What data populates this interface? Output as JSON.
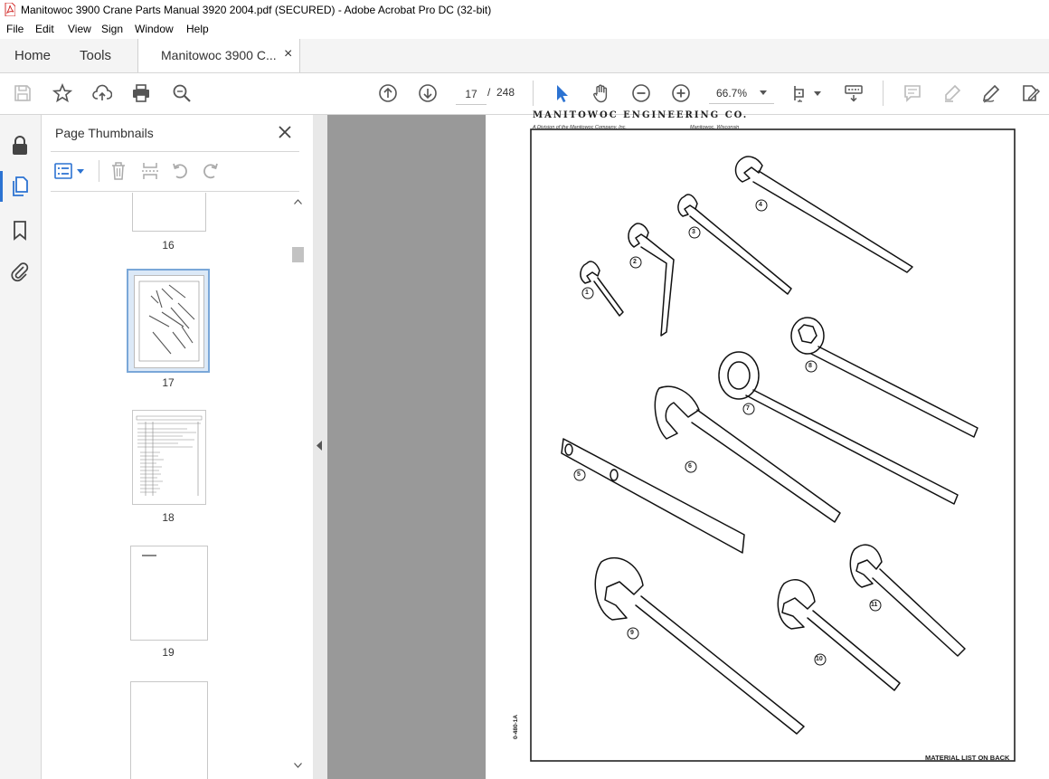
{
  "window": {
    "title": "Manitowoc 3900 Crane Parts Manual 3920 2004.pdf (SECURED) - Adobe Acrobat Pro DC (32-bit)"
  },
  "menu": [
    "File",
    "Edit",
    "View",
    "Sign",
    "Window",
    "Help"
  ],
  "tabs": {
    "home": "Home",
    "tools": "Tools",
    "document": "Manitowoc 3900 C...",
    "close": "×"
  },
  "toolbar": {
    "current_page": "17",
    "separator": "/",
    "total_pages": "248",
    "zoom": "66.7%"
  },
  "panel": {
    "title": "Page Thumbnails",
    "thumbnails": [
      {
        "label": "16"
      },
      {
        "label": "17"
      },
      {
        "label": "18"
      },
      {
        "label": "19"
      }
    ]
  },
  "document": {
    "header": "MANITOWOC ENGINEERING CO.",
    "left_caption": "A Division of the Manitowoc Company, Inc.",
    "right_caption": "Manitowoc, Wisconsin",
    "drawing_number": "0-480-1A",
    "footer": "MATERIAL LIST ON BACK",
    "callouts": [
      "1",
      "2",
      "3",
      "4",
      "5",
      "6",
      "7",
      "8",
      "9",
      "10",
      "11"
    ]
  },
  "colors": {
    "accent": "#2c73d2",
    "selected_thumb_border": "#7aa7d8",
    "canvas": "#999999"
  }
}
